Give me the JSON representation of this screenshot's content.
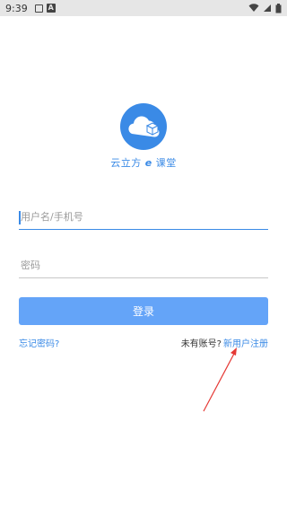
{
  "status_bar": {
    "time": "9:39",
    "icons": [
      "notification-box-icon",
      "a-icon",
      "wifi-icon",
      "cellular-icon",
      "battery-icon"
    ]
  },
  "logo": {
    "app_name": "云立方",
    "app_suffix": "课堂",
    "brand_color": "#3a8ae6"
  },
  "form": {
    "username_placeholder": "用户名/手机号",
    "password_placeholder": "密码",
    "login_label": "登录"
  },
  "links": {
    "forgot_password": "忘记密码?",
    "no_account": "未有账号?",
    "register": "新用户注册"
  },
  "colors": {
    "accent": "#3a8ae6",
    "button": "#64a4f8",
    "annotation_arrow": "#e53935"
  }
}
